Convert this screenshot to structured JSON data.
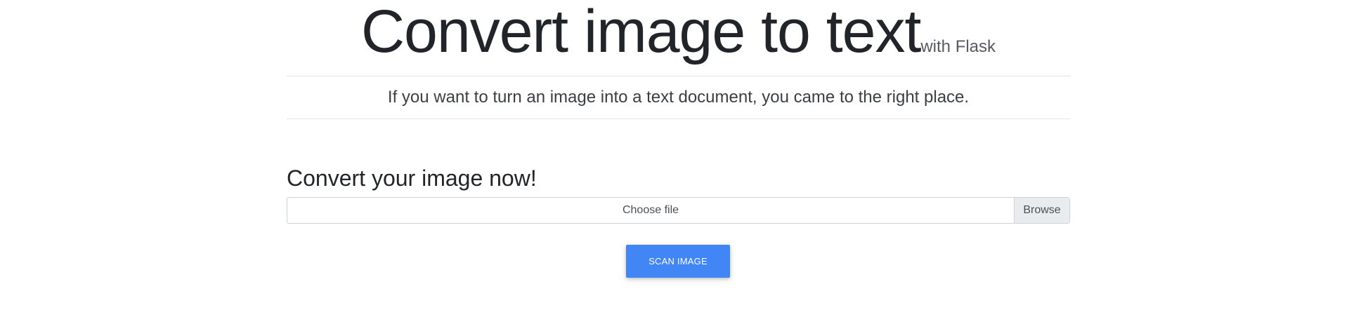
{
  "hero": {
    "title": "Convert image to text",
    "subtitle": "with Flask",
    "lead": "If you want to turn an image into a text document, you came to the right place."
  },
  "upload": {
    "heading": "Convert your image now!",
    "file_label": "Choose file",
    "browse_label": "Browse",
    "submit_label": "SCAN IMAGE"
  },
  "colors": {
    "primary_button": "#4285f4",
    "browse_background": "#e9ecef"
  }
}
